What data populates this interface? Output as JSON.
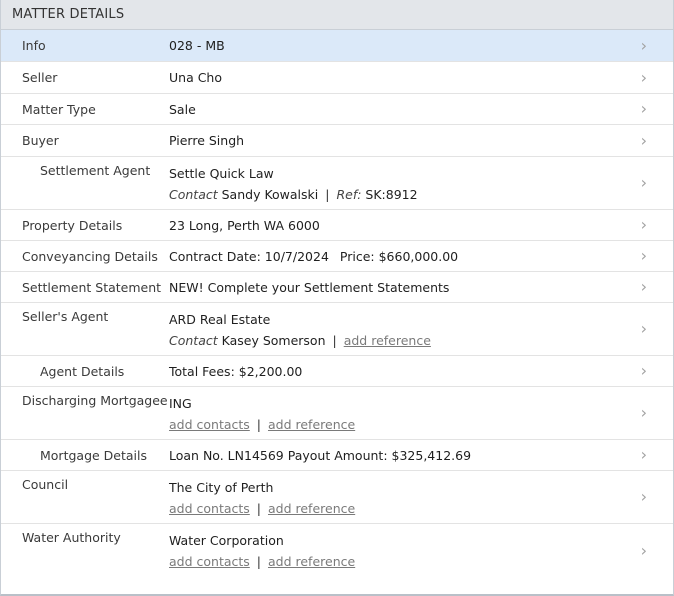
{
  "header": {
    "title": "MATTER DETAILS"
  },
  "rows": {
    "info": {
      "label": "Info",
      "value": "028 - MB"
    },
    "seller": {
      "label": "Seller",
      "value": "Una Cho"
    },
    "matter_type": {
      "label": "Matter Type",
      "value": "Sale"
    },
    "buyer": {
      "label": "Buyer",
      "value": "Pierre Singh"
    },
    "settlement_agent": {
      "label": "Settlement Agent",
      "value": "Settle Quick Law",
      "contact_prefix": "Contact",
      "contact": "Sandy Kowalski",
      "separator": "|",
      "ref_prefix": "Ref:",
      "ref": "SK:8912"
    },
    "property_details": {
      "label": "Property Details",
      "value": "23 Long, Perth WA 6000"
    },
    "conveyancing_details": {
      "label": "Conveyancing Details",
      "contract": "Contract Date: 10/7/2024",
      "price": "Price: $660,000.00"
    },
    "settlement_statement": {
      "label": "Settlement Statement",
      "value": "NEW! Complete your Settlement Statements"
    },
    "sellers_agent": {
      "label": "Seller's Agent",
      "value": "ARD Real Estate",
      "contact_prefix": "Contact",
      "contact": "Kasey Somerson",
      "separator": "|",
      "add_reference": "add reference"
    },
    "agent_details": {
      "label": "Agent Details",
      "value": "Total Fees: $2,200.00"
    },
    "discharging_mortgagee": {
      "label": "Discharging Mortgagee",
      "value": "ING",
      "add_contacts": "add contacts",
      "separator": "|",
      "add_reference": "add reference"
    },
    "mortgage_details": {
      "label": "Mortgage Details",
      "value": "Loan No. LN14569 Payout Amount: $325,412.69"
    },
    "council": {
      "label": "Council",
      "value": "The City of Perth",
      "add_contacts": "add contacts",
      "separator": "|",
      "add_reference": "add reference"
    },
    "water_authority": {
      "label": "Water Authority",
      "value": "Water Corporation",
      "add_contacts": "add contacts",
      "separator": "|",
      "add_reference": "add reference"
    }
  },
  "icons": {
    "row_arrow": "chevron-right-icon"
  }
}
